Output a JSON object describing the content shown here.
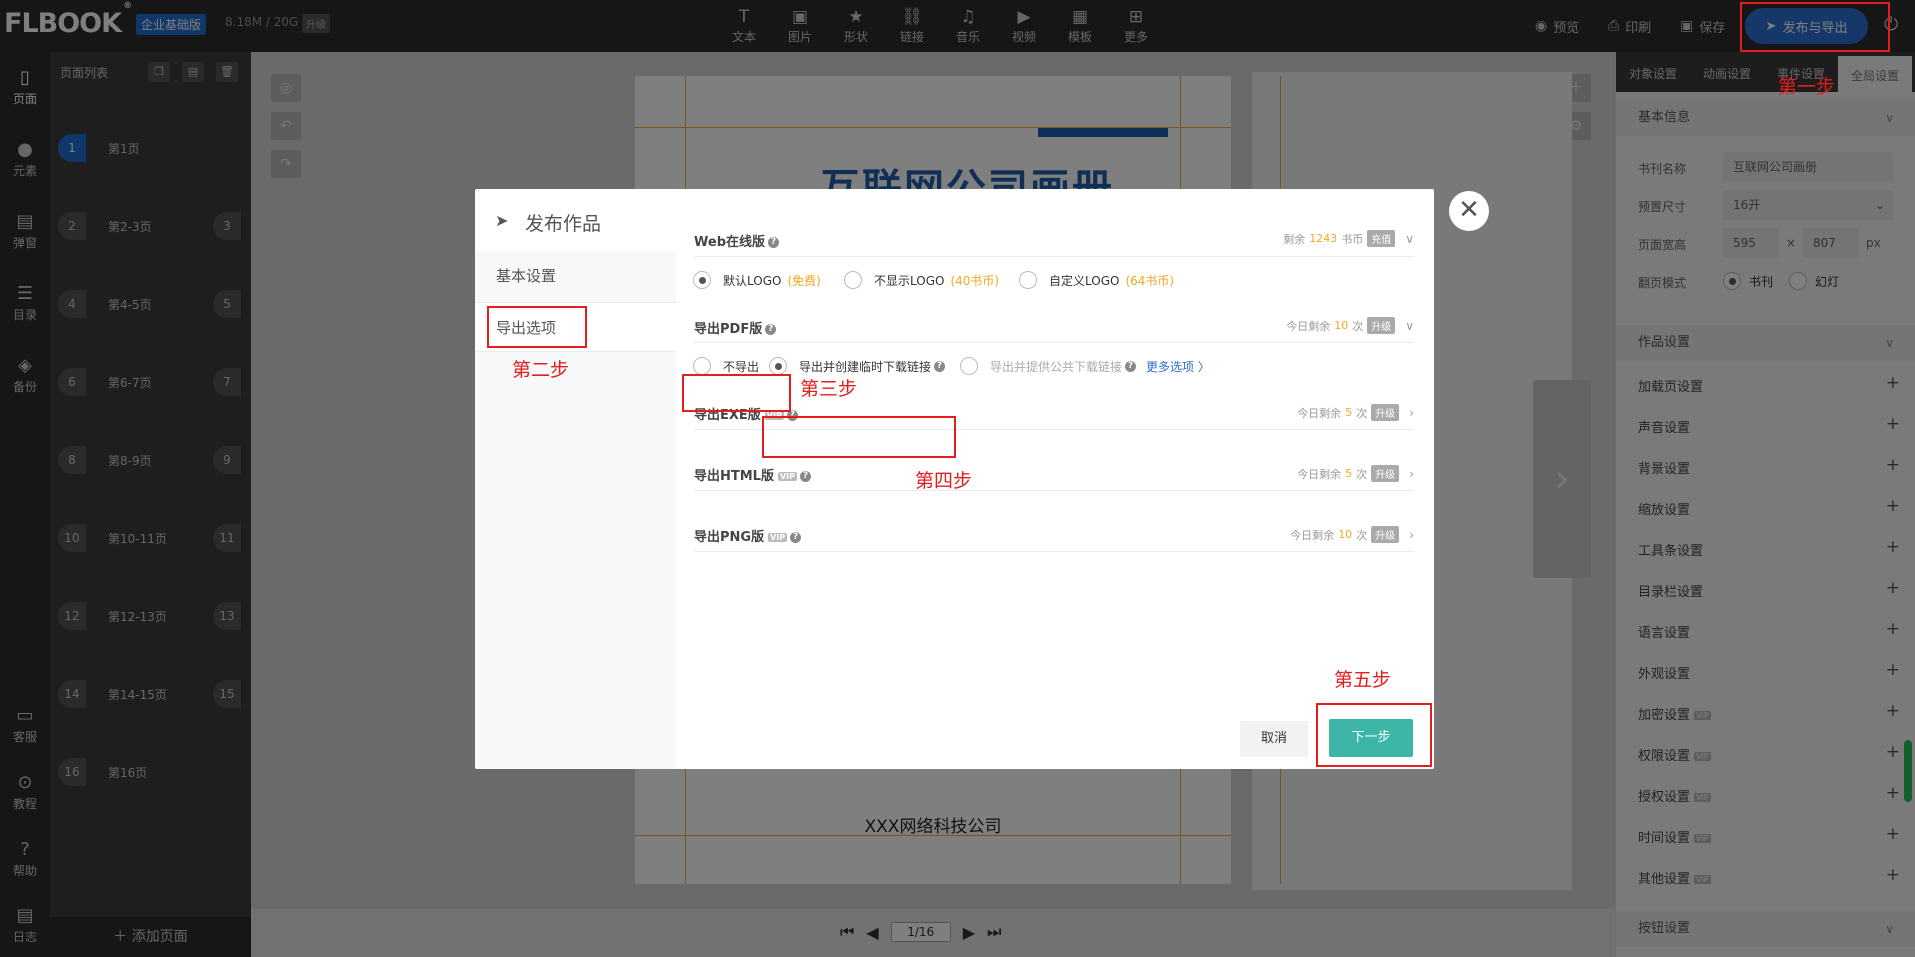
{
  "topbar": {
    "logo": "FLBOOK",
    "logo_mark": "®",
    "edition": "企业基础版",
    "storage": "8.18M / 20G",
    "upgrade": "升级",
    "tools": [
      {
        "label": "文本",
        "icon": "T"
      },
      {
        "label": "图片",
        "icon": "▣"
      },
      {
        "label": "形状",
        "icon": "★"
      },
      {
        "label": "链接",
        "icon": "⛓"
      },
      {
        "label": "音乐",
        "icon": "♫"
      },
      {
        "label": "视频",
        "icon": "▶"
      },
      {
        "label": "模板",
        "icon": "▦"
      },
      {
        "label": "更多",
        "icon": "⊞"
      }
    ],
    "preview": "预览",
    "print": "印刷",
    "save": "保存",
    "publish": "发布与导出"
  },
  "iconbar": {
    "page": "页面",
    "element": "元素",
    "popup": "弹窗",
    "catalog": "目录",
    "backup": "备份",
    "service": "客服",
    "tutorial": "教程",
    "help": "帮助",
    "log": "日志"
  },
  "pages_panel": {
    "title": "页面列表",
    "add_page": "添加页面",
    "rows": [
      {
        "l": "1",
        "label": "第1页",
        "r": ""
      },
      {
        "l": "2",
        "label": "第2-3页",
        "r": "3"
      },
      {
        "l": "4",
        "label": "第4-5页",
        "r": "5"
      },
      {
        "l": "6",
        "label": "第6-7页",
        "r": "7"
      },
      {
        "l": "8",
        "label": "第8-9页",
        "r": "9"
      },
      {
        "l": "10",
        "label": "第10-11页",
        "r": "11"
      },
      {
        "l": "12",
        "label": "第12-13页",
        "r": "13"
      },
      {
        "l": "14",
        "label": "第14-15页",
        "r": "15"
      },
      {
        "l": "16",
        "label": "第16页",
        "r": ""
      }
    ]
  },
  "canvas": {
    "title_text": "互联网公司画册",
    "company": "XXX网络科技公司",
    "page_indicator": "1/16"
  },
  "right_panel": {
    "tabs": [
      "对象设置",
      "动画设置",
      "事件设置",
      "全局设置"
    ],
    "basic_info": "基本信息",
    "book_name_label": "书刊名称",
    "book_name": "互联网公司画册",
    "size_label": "预置尺寸",
    "size": "16开",
    "dims_label": "页面宽高",
    "width": "595",
    "times": "×",
    "height": "807",
    "unit": "px",
    "flip_label": "翻页模式",
    "flip_book": "书刊",
    "flip_slide": "幻灯",
    "work_settings": "作品设置",
    "items": [
      {
        "label": "加载页设置",
        "vip": ""
      },
      {
        "label": "声音设置",
        "vip": ""
      },
      {
        "label": "背景设置",
        "vip": ""
      },
      {
        "label": "缩放设置",
        "vip": ""
      },
      {
        "label": "工具条设置",
        "vip": ""
      },
      {
        "label": "目录栏设置",
        "vip": ""
      },
      {
        "label": "语言设置",
        "vip": ""
      },
      {
        "label": "外观设置",
        "vip": ""
      },
      {
        "label": "加密设置",
        "vip": "VIP"
      },
      {
        "label": "权限设置",
        "vip": "VIP"
      },
      {
        "label": "授权设置",
        "vip": "VIP"
      },
      {
        "label": "时间设置",
        "vip": "VIP"
      },
      {
        "label": "其他设置",
        "vip": "VIP"
      }
    ],
    "button_settings": "按钮设置"
  },
  "modal": {
    "title": "发布作品",
    "side": [
      "基本设置",
      "导出选项"
    ],
    "web": {
      "title": "Web在线版",
      "remain_prefix": "剩余",
      "remain_value": "1243",
      "remain_suffix": "书币",
      "action": "充值",
      "options": [
        {
          "label": "默认LOGO",
          "note": "(免费)"
        },
        {
          "label": "不显示LOGO",
          "note": "(40书币)"
        },
        {
          "label": "自定义LOGO",
          "note": "(64书币)"
        }
      ]
    },
    "pdf": {
      "title": "导出PDF版",
      "remain_prefix": "今日剩余",
      "remain_value": "10",
      "remain_suffix": "次",
      "action": "升级",
      "opt_none": "不导出",
      "opt_temp": "导出并创建临时下载链接",
      "opt_public": "导出并提供公共下载链接",
      "more": "更多选项 〉"
    },
    "exe": {
      "title": "导出EXE版",
      "remain_prefix": "今日剩余",
      "remain_value": "5",
      "remain_suffix": "次",
      "action": "升级"
    },
    "html": {
      "title": "导出HTML版",
      "remain_prefix": "今日剩余",
      "remain_value": "5",
      "remain_suffix": "次",
      "action": "升级"
    },
    "png": {
      "title": "导出PNG版",
      "remain_prefix": "今日剩余",
      "remain_value": "10",
      "remain_suffix": "次",
      "action": "升级"
    },
    "vip": "VIP",
    "cancel": "取消",
    "next": "下一步"
  },
  "annotations": {
    "step1": "第一步",
    "step2": "第二步",
    "step3": "第三步",
    "step4": "第四步",
    "step5": "第五步"
  },
  "colors": {
    "accent": "#2c6fd4",
    "next_button": "#3db5a7",
    "annotation_red": "#e41e1e",
    "coin_orange": "#f5a623"
  }
}
